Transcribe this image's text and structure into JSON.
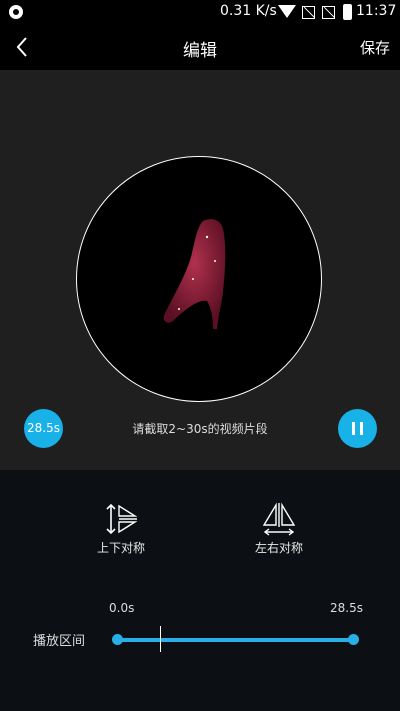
{
  "status_bar": {
    "speed": "0.31 K/s",
    "time": "11:37"
  },
  "header": {
    "title": "编辑",
    "save_label": "保存"
  },
  "preview": {
    "duration_badge": "28.5s",
    "hint": "请截取2~30s的视频片段",
    "accent": "#18b1e8"
  },
  "symmetry": {
    "vertical_label": "上下对称",
    "horizontal_label": "左右对称"
  },
  "range": {
    "label": "播放区间",
    "start": "0.0s",
    "end": "28.5s",
    "playhead_fraction": 0.18
  }
}
